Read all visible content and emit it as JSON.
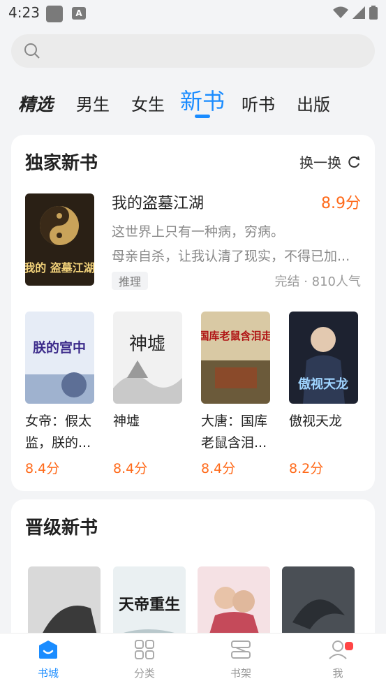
{
  "status": {
    "time": "4:23",
    "icon_b": "A"
  },
  "search": {
    "icon": "search-icon"
  },
  "tabs": [
    {
      "label": "精选"
    },
    {
      "label": "男生"
    },
    {
      "label": "女生"
    },
    {
      "label": "新书"
    },
    {
      "label": "听书"
    },
    {
      "label": "出版"
    }
  ],
  "exclusive": {
    "title": "独家新书",
    "refresh_label": "换一换",
    "featured": {
      "title": "我的盗墓江湖",
      "score": "8.9分",
      "desc_line1": "这世界上只有一种病，穷病。",
      "desc_line2": "母亲自杀，让我认清了现实，不得已加...",
      "tag": "推理",
      "meta": "完结 · 810人气",
      "cover_text": "我的 盗墓江湖"
    },
    "books": [
      {
        "title": "女帝：假太监，朕的...",
        "score": "8.4分",
        "cover_text": "朕的宫中"
      },
      {
        "title": "神墟",
        "score": "8.4分",
        "cover_text": "神墟"
      },
      {
        "title": "大唐：国库老鼠含泪...",
        "score": "8.4分",
        "cover_text": "国库老鼠含泪走"
      },
      {
        "title": "傲视天龙",
        "score": "8.2分",
        "cover_text": "傲视天龙"
      }
    ]
  },
  "promoted": {
    "title": "晋级新书",
    "covers": [
      {
        "cover_text": ""
      },
      {
        "cover_text": "天帝重生"
      },
      {
        "cover_text": ""
      },
      {
        "cover_text": ""
      }
    ]
  },
  "bottom_nav": [
    {
      "label": "书城",
      "icon": "bookstore-icon",
      "active": true
    },
    {
      "label": "分类",
      "icon": "category-icon",
      "active": false
    },
    {
      "label": "书架",
      "icon": "bookshelf-icon",
      "active": false
    },
    {
      "label": "我",
      "icon": "profile-icon",
      "active": false
    }
  ],
  "colors": {
    "accent": "#1a8cff",
    "score": "#ff6a1a",
    "badge": "#ff4545"
  }
}
